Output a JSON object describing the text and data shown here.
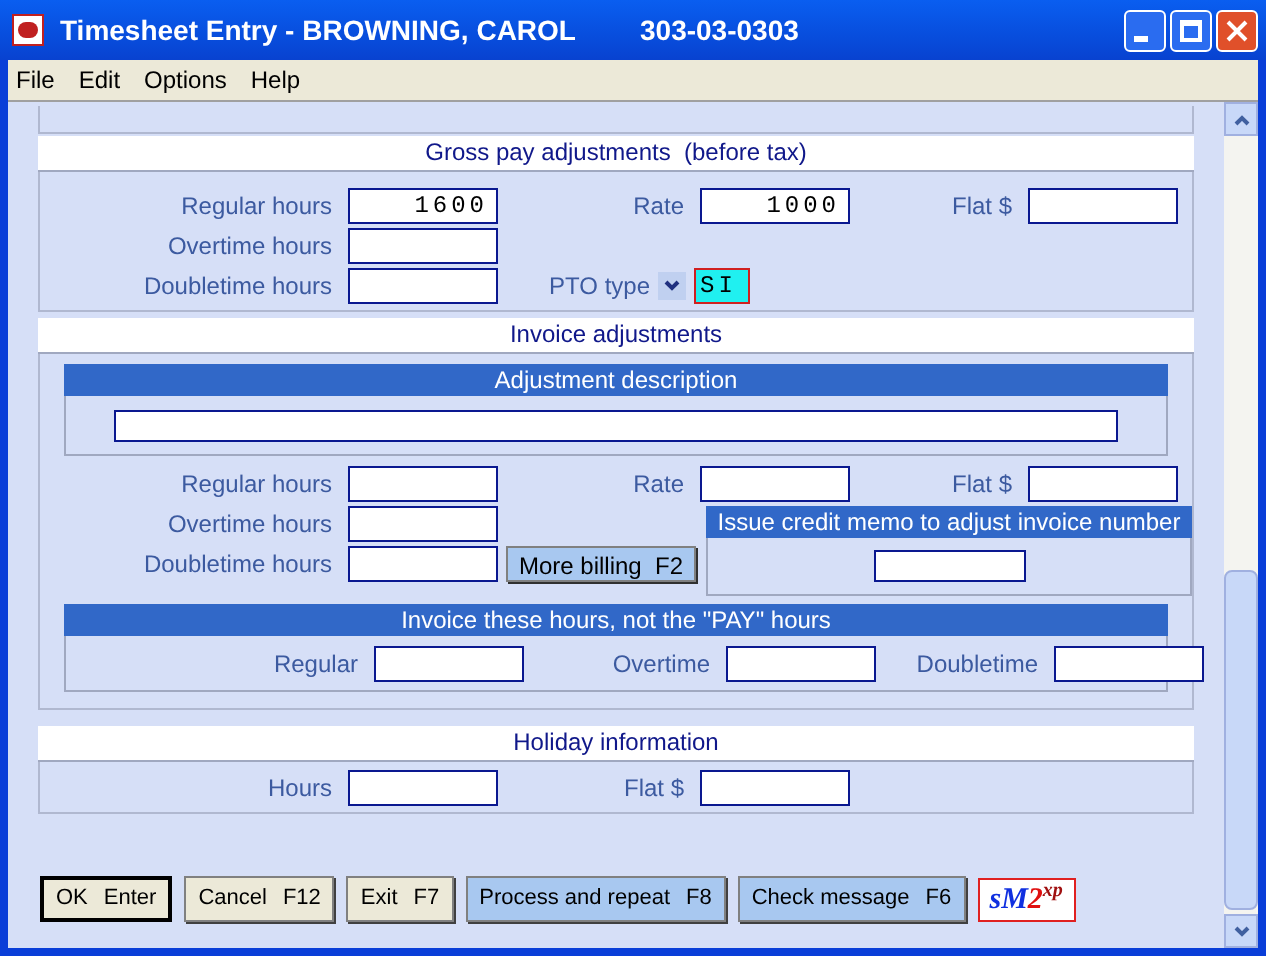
{
  "window": {
    "title": "Timesheet Entry - BROWNING, CAROL",
    "employee_id": "303-03-0303"
  },
  "menu": [
    {
      "label": "File"
    },
    {
      "label": "Edit"
    },
    {
      "label": "Options"
    },
    {
      "label": "Help"
    }
  ],
  "gross_pay": {
    "title": "Gross pay adjustments  (before tax)",
    "rows": [
      [
        {
          "label": "Regular hours",
          "value": "1600"
        },
        {
          "label": "Rate",
          "value": "1000"
        },
        {
          "label": "Flat $"
        }
      ],
      [
        {
          "label": "Overtime hours"
        }
      ],
      [
        {
          "label": "Doubletime hours"
        }
      ]
    ],
    "pto": {
      "label": "PTO type",
      "value": "SI",
      "focused": true
    }
  },
  "invoice": {
    "title": "Invoice adjustments",
    "description_title": "Adjustment description",
    "rows": [
      [
        {
          "label": "Regular hours"
        },
        {
          "label": "Rate"
        },
        {
          "label": "Flat $"
        }
      ],
      [
        {
          "label": "Overtime hours"
        }
      ],
      [
        {
          "label": "Doubletime hours"
        }
      ]
    ],
    "more_billing": "More billing  F2",
    "credit_memo_title": "Issue credit memo to adjust invoice number",
    "hours_title": "Invoice these hours, not the \"PAY\" hours",
    "hours": [
      {
        "label": "Regular"
      },
      {
        "label": "Overtime"
      },
      {
        "label": "Doubletime"
      }
    ]
  },
  "holiday": {
    "title": "Holiday information",
    "fields": [
      {
        "label": "Hours"
      },
      {
        "label": "Flat $"
      }
    ]
  },
  "buttons": [
    {
      "label": "OK",
      "key": "Enter",
      "kind": "default"
    },
    {
      "label": "Cancel",
      "key": "F12",
      "kind": "plain"
    },
    {
      "label": "Exit",
      "key": "F7",
      "kind": "plain"
    },
    {
      "label": "Process and repeat",
      "key": "F8",
      "kind": "action"
    },
    {
      "label": "Check message",
      "key": "F6",
      "kind": "action"
    }
  ],
  "logo": [
    {
      "text": "s",
      "color": "#1030e0"
    },
    {
      "text": "M",
      "color": "#1030e0"
    },
    {
      "text": "2",
      "color": "#e01010"
    },
    {
      "text": "xp",
      "color": "#a01010"
    }
  ]
}
